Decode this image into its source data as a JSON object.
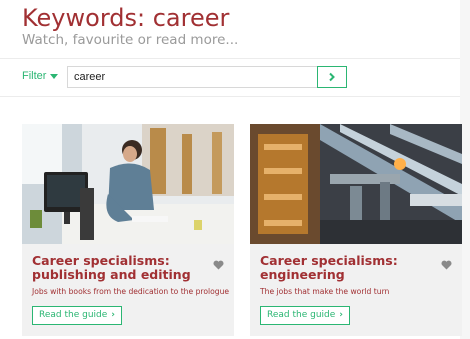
{
  "header": {
    "title": "Keywords: career",
    "subtitle": "Watch, favourite or read more..."
  },
  "filter": {
    "label": "Filter"
  },
  "search": {
    "value": "career",
    "button_icon": "chevron-right-icon"
  },
  "colors": {
    "brand": "#a13033",
    "accent": "#2bb673"
  },
  "cards": [
    {
      "title": "Career specialisms: publishing and editing",
      "description": "Jobs with books from the dedication to the prologue",
      "cta": "Read the guide",
      "icon": "heart-icon"
    },
    {
      "title": "Career specialisms: engineering",
      "description": "The jobs that make the world turn",
      "cta": "Read the guide",
      "icon": "heart-icon"
    }
  ]
}
